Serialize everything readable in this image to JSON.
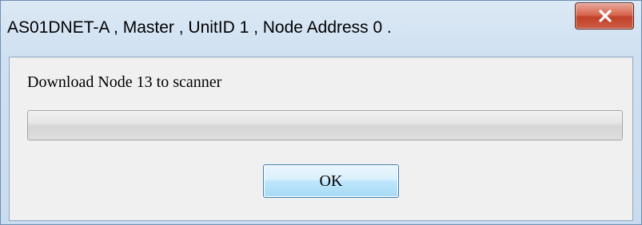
{
  "window": {
    "title": "AS01DNET-A , Master , UnitID 1 , Node Address 0 ."
  },
  "title_buttons": {
    "close_icon": "close-icon"
  },
  "dialog": {
    "message": "Download Node 13 to scanner",
    "progress_value": 0,
    "ok_label": "OK"
  },
  "colors": {
    "close_button": "#c2412a",
    "ok_border": "#3c7fb1",
    "progress_track": "#d5d5d5"
  }
}
